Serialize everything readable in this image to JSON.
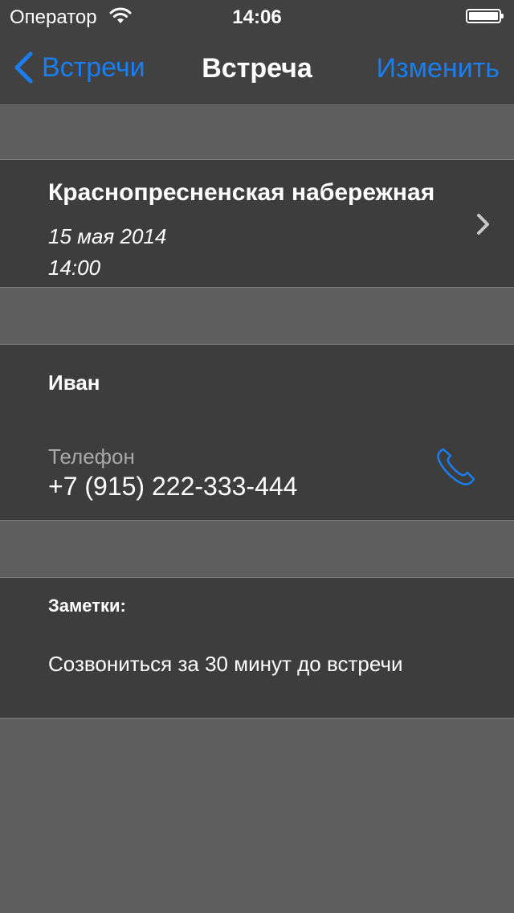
{
  "status_bar": {
    "carrier": "Оператор",
    "time": "14:06",
    "wifi_icon": "wifi-icon",
    "battery_icon": "battery-icon"
  },
  "nav": {
    "back_label": "Встречи",
    "title": "Встреча",
    "edit_label": "Изменить",
    "accent_color": "#1a7ef0"
  },
  "meeting": {
    "place": "Краснопресненская набережная",
    "date": "15 мая 2014",
    "time": "14:00",
    "disclosure_icon": "chevron-right-icon"
  },
  "contact": {
    "name": "Иван",
    "phone_label": "Телефон",
    "phone": "+7 (915) 222-333-444",
    "call_icon": "phone-icon"
  },
  "notes": {
    "label": "Заметки:",
    "text": "Созвониться за 30 минут до встречи"
  }
}
